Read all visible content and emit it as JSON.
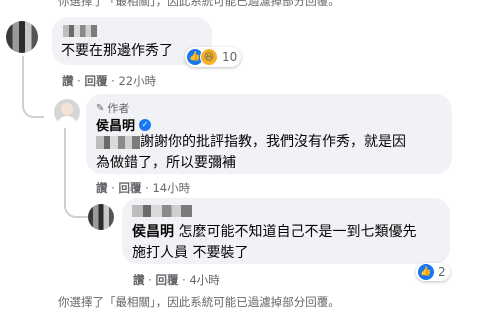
{
  "top_notice": "你選擇了「最相關」，因此系統可能已過濾掉部分回覆。",
  "comment1": {
    "text": "不要在那邊作秀了",
    "reaction_count": "10",
    "actions": {
      "like": "讚",
      "reply": "回覆",
      "time": "22小時"
    }
  },
  "comment2": {
    "badge": "作者",
    "name": "侯昌明",
    "line1": "謝謝你的批評指教，我們沒有作秀，就是因",
    "line2": "為做錯了，所以要彌補",
    "actions": {
      "like": "讚",
      "reply": "回覆",
      "time": "14小時"
    }
  },
  "comment3": {
    "mention": "侯昌明",
    "line1": "怎麼可能不知道自己不是一到七類優先",
    "line2": "施打人員 不要裝了",
    "reaction_count": "2",
    "actions": {
      "like": "讚",
      "reply": "回覆",
      "time": "4小時"
    }
  },
  "bottom_notice": "你選擇了「最相關」，因此系統可能已過濾掉部分回覆。",
  "separator": "·",
  "colors": {
    "like_blue": "#1877f2",
    "bubble": "#f0f2f5",
    "meta": "#65676b"
  }
}
